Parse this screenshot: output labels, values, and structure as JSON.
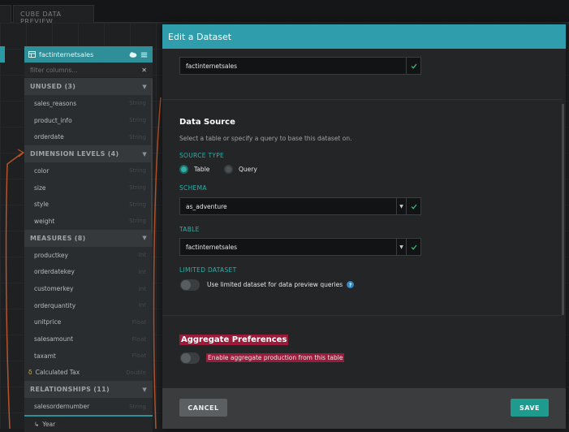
{
  "tabs": {
    "first": "",
    "second": "CUBE DATA PREVIEW"
  },
  "panel": {
    "title": "factinternetsales",
    "filter_placeholder": "filter columns...",
    "sections": {
      "unused": "UNUSED (3)",
      "dimension_levels": "DIMENSION LEVELS (4)",
      "measures": "MEASURES (8)",
      "relationships": "RELATIONSHIPS (11)"
    },
    "unused_rows": [
      {
        "name": "sales_reasons",
        "type": "String"
      },
      {
        "name": "product_info",
        "type": "String"
      },
      {
        "name": "orderdate",
        "type": "String"
      }
    ],
    "dimension_rows": [
      {
        "name": "color",
        "type": "String"
      },
      {
        "name": "size",
        "type": "String"
      },
      {
        "name": "style",
        "type": "String"
      },
      {
        "name": "weight",
        "type": "String"
      }
    ],
    "measure_rows": [
      {
        "name": "productkey",
        "type": "Int"
      },
      {
        "name": "orderdatekey",
        "type": "Int"
      },
      {
        "name": "customerkey",
        "type": "Int"
      },
      {
        "name": "orderquantity",
        "type": "Int"
      },
      {
        "name": "unitprice",
        "type": "Float"
      },
      {
        "name": "salesamount",
        "type": "Float"
      },
      {
        "name": "taxamt",
        "type": "Float"
      },
      {
        "name": "Calculated Tax",
        "type": "Double"
      }
    ],
    "relationship_rows": [
      {
        "name": "salesordernumber",
        "type": "String"
      },
      {
        "name": "Year",
        "type": ""
      }
    ]
  },
  "modal": {
    "title": "Edit a Dataset",
    "name_value": "factinternetsales",
    "data_source": {
      "heading": "Data Source",
      "description": "Select a table or specify a query to base this dataset on.",
      "source_type_label": "SOURCE TYPE",
      "option_table": "Table",
      "option_query": "Query",
      "schema_label": "SCHEMA",
      "schema_value": "as_adventure",
      "table_label": "TABLE",
      "table_value": "factinternetsales",
      "limited_label": "LIMITED DATASET",
      "limited_text": "Use limited dataset for data preview queries",
      "help": "?"
    },
    "aggregate": {
      "heading": "Aggregate Preferences",
      "toggle_text": "Enable aggregate production from this table"
    },
    "buttons": {
      "cancel": "CANCEL",
      "save": "SAVE"
    }
  },
  "colors": {
    "accent": "#2f9dac",
    "check": "#3cc07a",
    "highlight": "#9b1c3a",
    "save": "#1f9a8f"
  }
}
